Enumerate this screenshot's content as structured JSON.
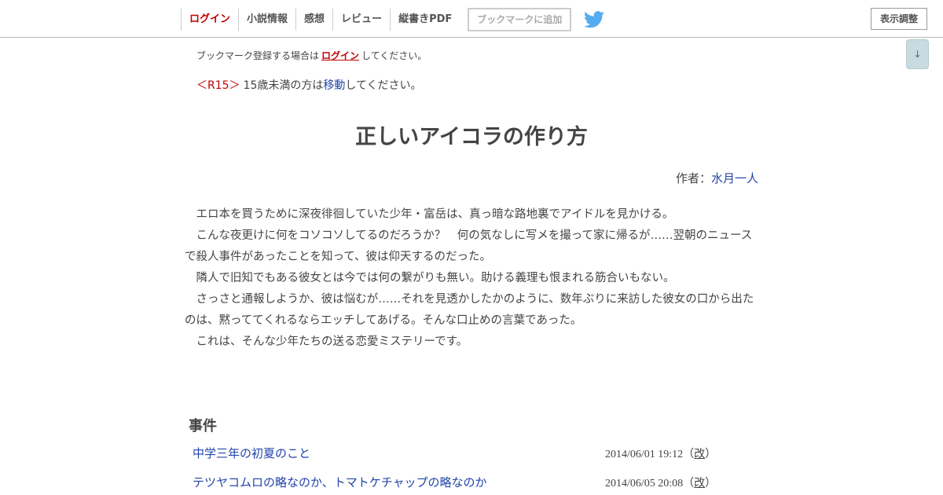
{
  "header": {
    "nav": [
      {
        "label": "ログイン"
      },
      {
        "label": "小説情報"
      },
      {
        "label": "感想"
      },
      {
        "label": "レビュー"
      },
      {
        "label": "縦書きPDF"
      }
    ],
    "bookmark_button": "ブックマークに追加",
    "twitter_icon": "twitter-bird-icon",
    "display_button": "表示調整",
    "scroll_button": "↓"
  },
  "bookmark_note": {
    "prefix": "ブックマーク登録する場合は",
    "link": "ログイン",
    "suffix": "してください。"
  },
  "r15_note": {
    "tag": "＜R15＞",
    "prefix": "15歳未満の方は",
    "link": "移動",
    "suffix": "してください。"
  },
  "novel": {
    "title": "正しいアイコラの作り方",
    "author_label": "作者：",
    "author_name": "水月一人",
    "summary": [
      "　エロ本を買うために深夜徘徊していた少年・富岳は、真っ暗な路地裏でアイドルを見かける。",
      "　こんな夜更けに何をコソコソしてるのだろうか？　何の気なしに写メを撮って家に帰るが……翌朝のニュースで殺人事件があったことを知って、彼は仰天するのだった。",
      "　隣人で旧知でもある彼女とは今では何の繋がりも無い。助ける義理も恨まれる筋合いもない。",
      "　さっさと通報しようか、彼は悩むが……それを見透かしたかのように、数年ぶりに来訪した彼女の口から出たのは、黙っててくれるならエッチしてあげる。そんな口止めの言葉であった。",
      "　これは、そんな少年たちの送る恋愛ミステリーです。"
    ]
  },
  "chapters": {
    "heading": "事件",
    "items": [
      {
        "title": "中学三年の初夏のこと",
        "date": "2014/06/01 19:12",
        "edit_open": "（",
        "edit": "改",
        "edit_close": "）"
      },
      {
        "title": "テツヤコムロの略なのか、トマトケチャップの略なのか",
        "date": "2014/06/05 20:08",
        "edit_open": "（",
        "edit": "改",
        "edit_close": "）"
      }
    ]
  },
  "colors": {
    "accent_red": "#c00000",
    "link_blue": "#2244aa",
    "text": "#444444",
    "twitter_blue": "#55acee"
  }
}
